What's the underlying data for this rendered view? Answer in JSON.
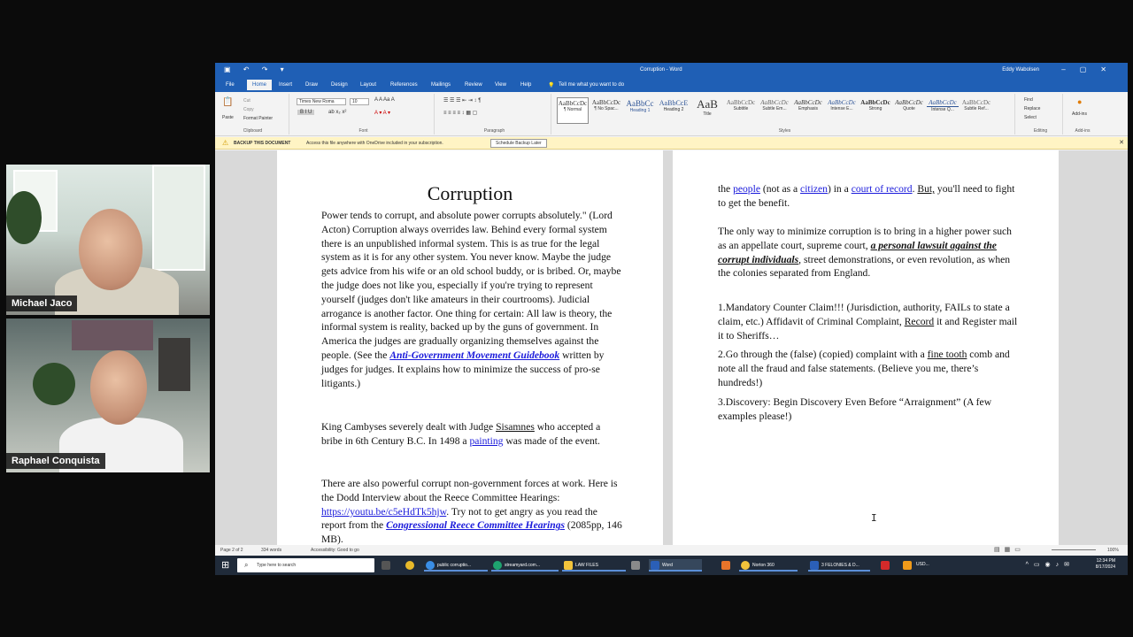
{
  "participants": [
    {
      "name": "Michael Jaco"
    },
    {
      "name": "Raphael Conquista"
    }
  ],
  "word": {
    "title": "Corruption - Word",
    "user": "Eddy Wabolsen",
    "tabs": [
      "File",
      "Home",
      "Insert",
      "Draw",
      "Design",
      "Layout",
      "References",
      "Mailings",
      "Review",
      "View",
      "Help"
    ],
    "tell_me": "Tell me what you want to do",
    "font_name": "Times New Roma",
    "font_size": "10",
    "groups": {
      "clipboard": "Clipboard",
      "font": "Font",
      "paragraph": "Paragraph",
      "styles": "Styles",
      "editing": "Editing",
      "addins": "Add-ins"
    },
    "clipboard_items": {
      "paste": "Paste",
      "cut": "Cut",
      "copy": "Copy",
      "format_painter": "Format Painter"
    },
    "styles": [
      {
        "preview": "AaBbCcDc",
        "name": "¶ Normal"
      },
      {
        "preview": "AaBbCcDc",
        "name": "¶ No Spac..."
      },
      {
        "preview": "AaBbCc",
        "name": "Heading 1"
      },
      {
        "preview": "AaBbCcE",
        "name": "Heading 2"
      },
      {
        "preview": "AaB",
        "name": "Title"
      },
      {
        "preview": "AaBbCcDc",
        "name": "Subtitle"
      },
      {
        "preview": "AaBbCcDc",
        "name": "Subtle Em..."
      },
      {
        "preview": "AaBbCcDc",
        "name": "Emphasis"
      },
      {
        "preview": "AaBbCcDc",
        "name": "Intense E..."
      },
      {
        "preview": "AaBbCcDc",
        "name": "Strong"
      },
      {
        "preview": "AaBbCcDc",
        "name": "Quote"
      },
      {
        "preview": "AaBbCcDc",
        "name": "Intense Q..."
      },
      {
        "preview": "AaBbCcDc",
        "name": "Subtle Ref..."
      }
    ],
    "editing_items": {
      "find": "Find",
      "replace": "Replace",
      "select": "Select"
    },
    "addins_label": "Add-ins",
    "backup": {
      "label": "BACKUP THIS DOCUMENT",
      "message": "Access this file anywhere with OneDrive included in your subscription.",
      "button": "Schedule Backup Later"
    },
    "status": {
      "page": "Page 2 of 2",
      "words": "334 words",
      "accessibility": "Accessibility: Good to go",
      "zoom": "100%"
    }
  },
  "document": {
    "title": "Corruption",
    "p1": {
      "a": "Power tends to corrupt, and absolute power corrupts absolutely.\" (Lord Acton) Corruption always overrides law. Behind every formal system there is an unpublished informal system. This is as true for the legal system as it is for any other system. You never know. Maybe the judge gets advice from his wife or an old school buddy, or is bribed. Or, maybe the judge does not like you, especially if you're trying to represent yourself (judges don't like amateurs in their courtrooms). Judicial arrogance is another factor. One thing for certain: All law is theory, the informal system is reality, backed up by the guns of government. In America the judges are gradually organizing themselves against the people. (See the ",
      "link": "Anti-Government Movement Guidebook",
      "b": " written by judges for judges. It explains how to minimize the success of pro-se litigants.)"
    },
    "p2": {
      "a": "King Cambyses severely dealt with Judge ",
      "name": "Sisamnes",
      "b": " who accepted a bribe in 6th Century B.C. In 1498 a ",
      "link": "painting",
      "c": " was made of the event."
    },
    "p3": {
      "a": "There are also powerful corrupt non-government forces at work. Here is the Dodd Interview about the Reece Committee Hearings: ",
      "url": "https://youtu.be/c5eHdTk5hjw",
      "b": ". Try not to get angry as you read the report from the ",
      "link": "Congressional Reece Committee Hearings",
      "c": " (2085pp, 146 MB)."
    },
    "q1": {
      "a": "the ",
      "people": "people",
      "b": " (not as a ",
      "citizen": "citizen",
      "c": ") in a ",
      "court": "court of record",
      "d": ". ",
      "but": "But,",
      "e": " you'll need to fight to get the benefit."
    },
    "q2": {
      "a": "The only way to minimize corruption is to bring in a higher power such as an appellate court, supreme court, ",
      "emph": "a personal lawsuit against the corrupt individuals",
      "b": ", street demonstrations, or even revolution, as when the colonies separated from England."
    },
    "q3": {
      "a": "1.Mandatory Counter Claim!!! (Jurisdiction, authority, FAILs to state a claim, etc.) Affidavit of Criminal Complaint, ",
      "record": "Record",
      "b": " it and Register mail it to Sheriffs…"
    },
    "q4": {
      "a": "2.Go through the (false) (copied) complaint with a ",
      "comb": "fine tooth",
      "b": " comb and note all the fraud and false statements. (Believe you me, there’s hundreds!)"
    },
    "q5": "3.Discovery: Begin Discovery Even Before “Arraignment” (A few examples please!)"
  },
  "taskbar": {
    "search_placeholder": "Type here to search",
    "apps": [
      "public corruptio...",
      "streamyard.com...",
      "LAW FILES",
      "Word",
      "Norton 360",
      "3 FELONIES & D..."
    ],
    "weather": "USD...",
    "time": "12:34 PM",
    "date": "8/17/2024"
  },
  "colors": {
    "word_blue": "#1f5fb5",
    "link": "#1a1adb",
    "backup_bar": "#fff4c4",
    "taskbar": "#202b3a"
  }
}
